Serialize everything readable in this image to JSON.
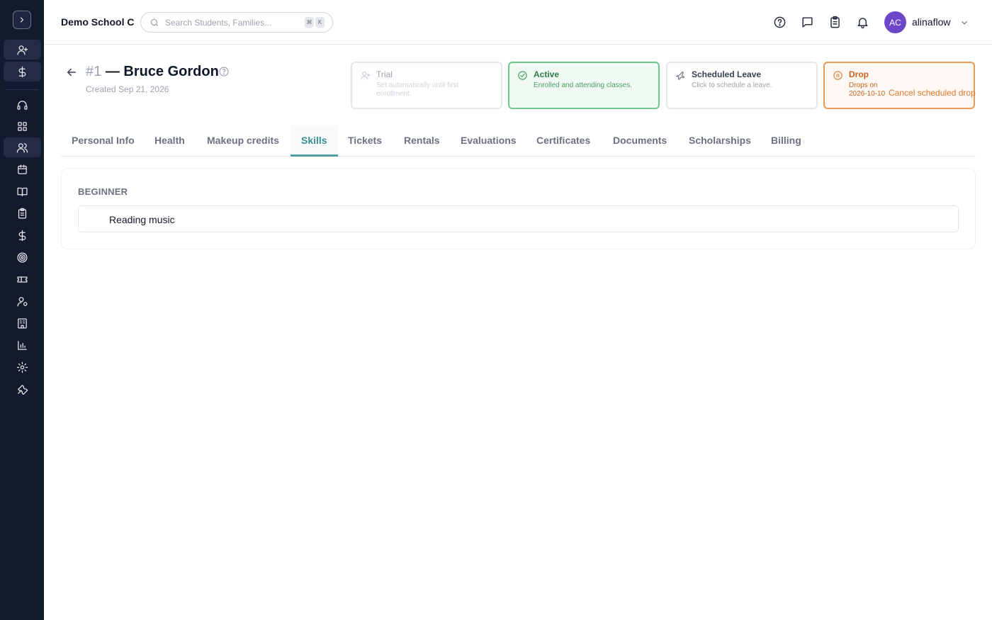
{
  "sidebar": {
    "toggle_icon": "chevron-right-icon",
    "items": [
      {
        "icon": "user-plus-icon"
      },
      {
        "icon": "dollar-icon"
      },
      {
        "icon": "headset-icon"
      },
      {
        "icon": "dashboard-icon"
      },
      {
        "icon": "users-icon"
      },
      {
        "icon": "calendar-icon"
      },
      {
        "icon": "book-icon"
      },
      {
        "icon": "clipboard-icon"
      },
      {
        "icon": "dollar-icon"
      },
      {
        "icon": "target-icon"
      },
      {
        "icon": "ticket-icon"
      },
      {
        "icon": "user-settings-icon"
      },
      {
        "icon": "building-icon"
      },
      {
        "icon": "bar-chart-icon"
      },
      {
        "icon": "gear-icon"
      },
      {
        "icon": "wrench-icon"
      }
    ]
  },
  "topbar": {
    "school_name": "Demo School C",
    "search_placeholder": "Search Students, Families...",
    "shortcut_keys": [
      "⌘",
      "K"
    ],
    "user_initials": "AC",
    "user_name": "alinaflow"
  },
  "student": {
    "number": "#1",
    "name": "— Bruce Gordon",
    "created": "Created Sep 21, 2026"
  },
  "status_cards": {
    "trial": {
      "title": "Trial",
      "desc": "Set automatically until first enrollment."
    },
    "active": {
      "title": "Active",
      "desc": "Enrolled and attending classes."
    },
    "leave": {
      "title": "Scheduled Leave",
      "desc": "Click to schedule a leave."
    },
    "drop": {
      "title": "Drop",
      "desc": "Drops on 2026-10-10",
      "action": "Cancel scheduled drop"
    }
  },
  "colors": {
    "sidebar_bg": "#141a2e",
    "active_green": "#6fc58b",
    "drop_orange": "#ee9a55",
    "tab_accent": "#4f9ea1",
    "avatar_purple": "#6d47c9"
  },
  "tabs": [
    {
      "label": "Personal Info"
    },
    {
      "label": "Health"
    },
    {
      "label": "Makeup credits"
    },
    {
      "label": "Skills"
    },
    {
      "label": "Tickets"
    },
    {
      "label": "Rentals"
    },
    {
      "label": "Evaluations"
    },
    {
      "label": "Certificates"
    },
    {
      "label": "Documents"
    },
    {
      "label": "Scholarships"
    },
    {
      "label": "Billing"
    }
  ],
  "active_tab": "Skills",
  "skills": {
    "level": "BEGINNER",
    "items": [
      {
        "label": "Reading music"
      }
    ]
  }
}
